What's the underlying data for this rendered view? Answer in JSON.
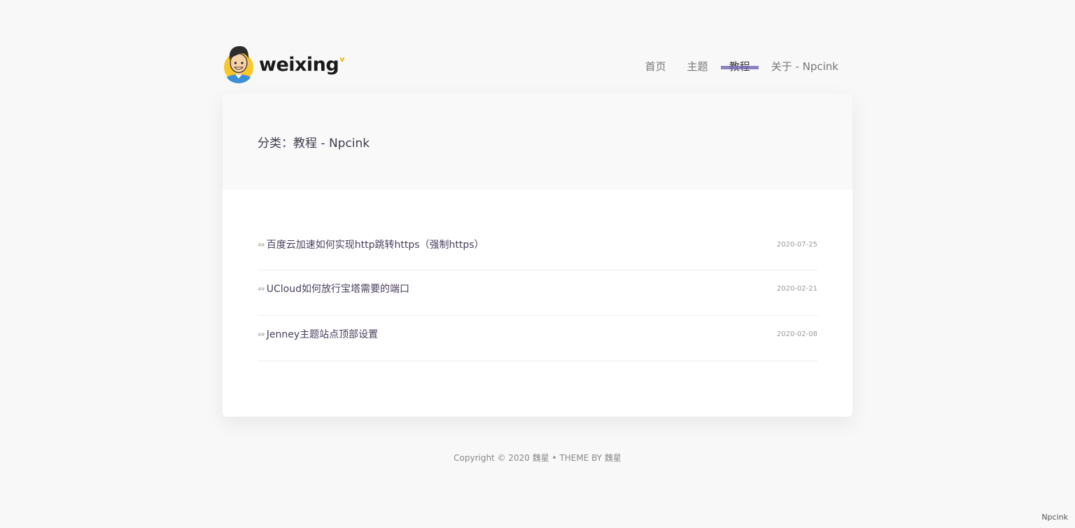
{
  "header": {
    "logo_text": "weixing",
    "logo_sup": "v"
  },
  "nav": {
    "items": [
      {
        "label": "首页"
      },
      {
        "label": "主题"
      },
      {
        "label": "教程"
      },
      {
        "label": "关于 - Npcink"
      }
    ],
    "active_index": 2
  },
  "category": {
    "title": "分类：教程 - Npcink"
  },
  "posts": [
    {
      "marker": "##",
      "title": "百度云加速如何实现http跳转https（强制https）",
      "date": "2020-07-25"
    },
    {
      "marker": "##",
      "title": "UCloud如何放行宝塔需要的端口",
      "date": "2020-02-21"
    },
    {
      "marker": "##",
      "title": "Jenney主题站点顶部设置",
      "date": "2020-02-08"
    }
  ],
  "footer": {
    "copyright": "Copyright © 2020 魏星 • THEME BY 魏星"
  },
  "corner": {
    "label": "Npcink"
  },
  "colors": {
    "accent": "#7b6fb5",
    "background": "#f8f8f8",
    "logo_sup": "#f2b600"
  }
}
